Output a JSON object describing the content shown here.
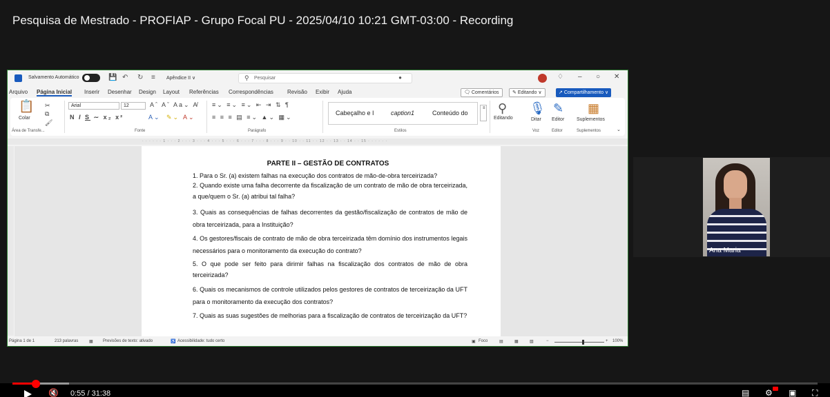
{
  "video": {
    "title": "Pesquisa de Mestrado - PROFIAP - Grupo Focal PU - 2025/04/10 10:21 GMT-03:00 - Recording",
    "time_display": "0:55 / 31:38",
    "progress_fraction": 0.029,
    "accent_color": "#ff0000"
  },
  "word": {
    "autosave_label": "Salvamento Automático",
    "doc_name": "Apêndice II ∨",
    "search_placeholder": "Pesquisar",
    "menu": [
      "Arquivo",
      "Página Inicial",
      "Inserir",
      "Desenhar",
      "Design",
      "Layout",
      "Referências",
      "Correspondências",
      "Revisão",
      "Exibir",
      "Ajuda"
    ],
    "comments_button": "Comentários",
    "editing_button": "Editando ∨",
    "share_button": "Compartilhamento ∨",
    "ribbon": {
      "paste_label": "Colar",
      "font_name": "Arial",
      "font_size": "12",
      "styles": [
        "Cabeçalho e I",
        "caption1",
        "Conteúdo do"
      ],
      "editing_label": "Editando",
      "dictate_label": "Ditar",
      "editor_label": "Editor",
      "addins_label": "Suplementos",
      "group_labels": {
        "clipboard": "Área de Transfe...",
        "font": "Fonte",
        "paragraph": "Parágrafo",
        "styles": "Estilos",
        "voice": "Voz",
        "editor": "Editor",
        "addins": "Suplementos"
      }
    },
    "document": {
      "heading": "PARTE II – GESTÃO DE CONTRATOS",
      "paragraphs": [
        "1. Para o Sr. (a) existem falhas na execução dos contratos de mão-de-obra terceirizada?",
        "2. Quando existe uma falha decorrente da fiscalização de um contrato de mão de obra terceirizada, a que/quem o Sr. (a) atribui tal falha?",
        "3. Quais as consequências de falhas decorrentes da gestão/fiscalização de contratos de mão de obra terceirizada, para a Instituição?",
        "4. Os gestores/fiscais de contrato de mão de obra terceirizada têm domínio dos instrumentos legais necessários para o monitoramento da execução do contrato?",
        "5. O que pode ser feito para dirimir falhas na fiscalização dos contratos de mão de obra terceirizada?",
        "6. Quais os mecanismos de controle utilizados pelos gestores de contratos de terceirização da UFT para o monitoramento da execução dos contratos?",
        "7. Quais as suas sugestões de melhorias para a fiscalização de contratos de terceirização da UFT?"
      ]
    },
    "status": {
      "page": "Página 1 de 1",
      "words": "213 palavras",
      "predictions": "Previsões de texto: ativado",
      "accessibility": "Acessibilidade: tudo certo",
      "focus": "Foco",
      "zoom": "100%"
    }
  },
  "webcam": {
    "participant_name": "Ana Maria"
  }
}
